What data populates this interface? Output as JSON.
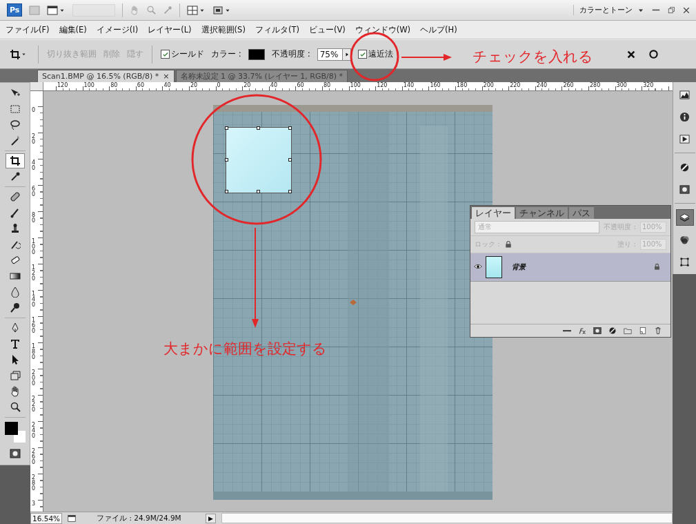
{
  "title_bar": {
    "logo": "Ps",
    "workspace": "カラーとトーン"
  },
  "menu": [
    "ファイル(F)",
    "編集(E)",
    "イメージ(I)",
    "レイヤー(L)",
    "選択範囲(S)",
    "フィルタ(T)",
    "ビュー(V)",
    "ウィンドウ(W)",
    "ヘルプ(H)"
  ],
  "options_bar": {
    "items": [
      {
        "kind": "text",
        "label": "切り抜き範囲",
        "disabled": true
      },
      {
        "kind": "text",
        "label": "削除",
        "disabled": true
      },
      {
        "kind": "text",
        "label": "隠す",
        "disabled": true
      },
      {
        "kind": "checkbox",
        "label": "シールド",
        "checked": true
      },
      {
        "kind": "swatch",
        "label": "カラー :"
      },
      {
        "kind": "field",
        "label": "不透明度 :",
        "value": "75%"
      },
      {
        "kind": "checkbox",
        "label": "遠近法",
        "checked": true
      }
    ]
  },
  "document_tabs": [
    {
      "label": "Scan1.BMP @ 16.5% (RGB/8) *",
      "close": "×",
      "selected": true
    },
    {
      "label": "名称未設定 1 @ 33.7% (レイヤー 1, RGB/8) *",
      "selected": false
    }
  ],
  "rulers": {
    "horizontal": [
      "120",
      "100",
      "80",
      "60",
      "40",
      "20",
      "0",
      "20",
      "40",
      "60",
      "80",
      "100",
      "120",
      "140",
      "160",
      "180",
      "200",
      "220",
      "240",
      "260",
      "280",
      "300",
      "320"
    ],
    "vertical": [
      "0",
      "20",
      "40",
      "60",
      "80",
      "100",
      "120",
      "140",
      "160",
      "180",
      "200",
      "220",
      "240",
      "260",
      "280",
      "3"
    ]
  },
  "tools": [
    {
      "kind": "move",
      "selected": false
    },
    {
      "kind": "marquee",
      "selected": false
    },
    {
      "kind": "lasso",
      "selected": false
    },
    {
      "kind": "wand",
      "selected": false
    },
    {
      "kind": "crop",
      "selected": true
    },
    {
      "kind": "eyedropper",
      "selected": false
    },
    {
      "kind": "healing",
      "selected": false
    },
    {
      "kind": "brush",
      "selected": false
    },
    {
      "kind": "stamp",
      "selected": false
    },
    {
      "kind": "history",
      "selected": false
    },
    {
      "kind": "eraser",
      "selected": false
    },
    {
      "kind": "gradient",
      "selected": false
    },
    {
      "kind": "blur",
      "selected": false
    },
    {
      "kind": "dodge",
      "selected": false
    },
    {
      "kind": "pen",
      "selected": false
    },
    {
      "kind": "type",
      "selected": false
    },
    {
      "kind": "pathsel",
      "selected": false
    },
    {
      "kind": "shape",
      "selected": false
    },
    {
      "kind": "hand",
      "selected": false
    },
    {
      "kind": "zoom",
      "selected": false
    }
  ],
  "dock": [
    {
      "kind": "histogram",
      "selected": false
    },
    {
      "kind": "info",
      "selected": false
    },
    {
      "kind": "navigator",
      "selected": false
    },
    {
      "kind": "adjust",
      "selected": false
    },
    {
      "kind": "mask",
      "selected": false
    },
    {
      "kind": "layers",
      "selected": true
    },
    {
      "kind": "channels",
      "selected": false
    },
    {
      "kind": "paths",
      "selected": false
    }
  ],
  "layers_panel": {
    "tabs": [
      {
        "label": "レイヤー",
        "selected": true
      },
      {
        "label": "チャンネル",
        "selected": false
      },
      {
        "label": "パス",
        "selected": false
      }
    ],
    "blend_mode": "通常",
    "opacity_label": "不透明度 :",
    "opacity": "100%",
    "lock_label": "ロック :",
    "fill_label": "塗り :",
    "fill": "100%",
    "controls_disabled": true,
    "layers": [
      {
        "name": "背景",
        "visible": true,
        "locked": true,
        "selected": true
      }
    ]
  },
  "status_bar": {
    "zoom": "16.54%",
    "file_info": "ファイル : 24.9M/24.9M",
    "menu_arrow": "▶"
  },
  "annotations": [
    {
      "text": "チェックを入れる"
    },
    {
      "text": "大まかに範囲を設定する"
    }
  ]
}
